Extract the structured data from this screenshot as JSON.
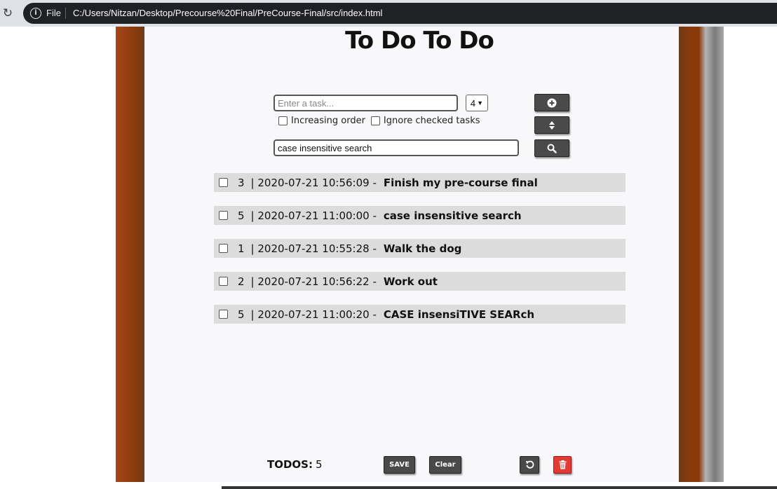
{
  "browser": {
    "reload_icon": "reload-icon",
    "info_icon": "info-icon",
    "scheme_label": "File",
    "url": "C:/Users/Nitzan/Desktop/Precourse%20Final/PreCourse-Final/src/index.html"
  },
  "app": {
    "title": "To Do To Do"
  },
  "controls": {
    "task_placeholder": "Enter a task...",
    "task_value": "",
    "priority_value": "4",
    "add_icon": "plus-circle-icon",
    "sort_icon": "sort-icon",
    "increasing_label": "Increasing order",
    "ignore_checked_label": "Ignore checked tasks",
    "search_value": "case insensitive search",
    "search_icon": "search-icon"
  },
  "todos": [
    {
      "priority": "3",
      "date": "| 2020-07-21 10:56:09 -",
      "text": "Finish my pre-course final"
    },
    {
      "priority": "5",
      "date": "| 2020-07-21 11:00:00 -",
      "text": "case insensitive search"
    },
    {
      "priority": "1",
      "date": "| 2020-07-21 10:55:28 -",
      "text": "Walk the dog"
    },
    {
      "priority": "2",
      "date": "| 2020-07-21 10:56:22 -",
      "text": "Work out"
    },
    {
      "priority": "5",
      "date": "| 2020-07-21 11:00:20 -",
      "text": "CASE insensiTIVE SEARch"
    }
  ],
  "footer": {
    "count_label": "TODOS:",
    "count_value": "5",
    "save_label": "SAVE",
    "clear_label": "Clear",
    "undo_icon": "undo-icon",
    "delete_icon": "trash-icon"
  },
  "colors": {
    "frame_wood": "#8a3a0a",
    "button_dark": "#4a4a4a",
    "delete_red": "#e53935",
    "row_bg": "#dcdcdc"
  }
}
